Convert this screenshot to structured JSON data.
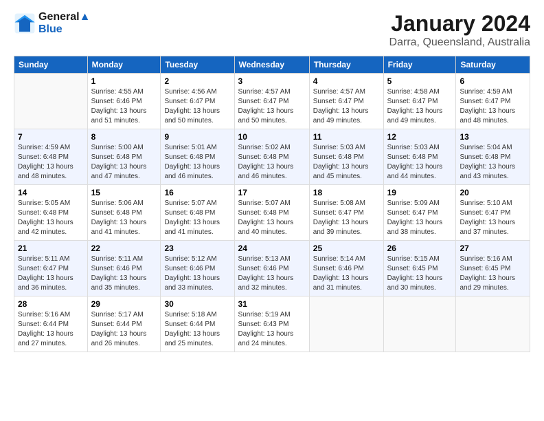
{
  "logo": {
    "line1": "General",
    "line2": "Blue"
  },
  "title": "January 2024",
  "subtitle": "Darra, Queensland, Australia",
  "header_days": [
    "Sunday",
    "Monday",
    "Tuesday",
    "Wednesday",
    "Thursday",
    "Friday",
    "Saturday"
  ],
  "weeks": [
    [
      {
        "day": "",
        "info": ""
      },
      {
        "day": "1",
        "info": "Sunrise: 4:55 AM\nSunset: 6:46 PM\nDaylight: 13 hours\nand 51 minutes."
      },
      {
        "day": "2",
        "info": "Sunrise: 4:56 AM\nSunset: 6:47 PM\nDaylight: 13 hours\nand 50 minutes."
      },
      {
        "day": "3",
        "info": "Sunrise: 4:57 AM\nSunset: 6:47 PM\nDaylight: 13 hours\nand 50 minutes."
      },
      {
        "day": "4",
        "info": "Sunrise: 4:57 AM\nSunset: 6:47 PM\nDaylight: 13 hours\nand 49 minutes."
      },
      {
        "day": "5",
        "info": "Sunrise: 4:58 AM\nSunset: 6:47 PM\nDaylight: 13 hours\nand 49 minutes."
      },
      {
        "day": "6",
        "info": "Sunrise: 4:59 AM\nSunset: 6:47 PM\nDaylight: 13 hours\nand 48 minutes."
      }
    ],
    [
      {
        "day": "7",
        "info": "Sunrise: 4:59 AM\nSunset: 6:48 PM\nDaylight: 13 hours\nand 48 minutes."
      },
      {
        "day": "8",
        "info": "Sunrise: 5:00 AM\nSunset: 6:48 PM\nDaylight: 13 hours\nand 47 minutes."
      },
      {
        "day": "9",
        "info": "Sunrise: 5:01 AM\nSunset: 6:48 PM\nDaylight: 13 hours\nand 46 minutes."
      },
      {
        "day": "10",
        "info": "Sunrise: 5:02 AM\nSunset: 6:48 PM\nDaylight: 13 hours\nand 46 minutes."
      },
      {
        "day": "11",
        "info": "Sunrise: 5:03 AM\nSunset: 6:48 PM\nDaylight: 13 hours\nand 45 minutes."
      },
      {
        "day": "12",
        "info": "Sunrise: 5:03 AM\nSunset: 6:48 PM\nDaylight: 13 hours\nand 44 minutes."
      },
      {
        "day": "13",
        "info": "Sunrise: 5:04 AM\nSunset: 6:48 PM\nDaylight: 13 hours\nand 43 minutes."
      }
    ],
    [
      {
        "day": "14",
        "info": "Sunrise: 5:05 AM\nSunset: 6:48 PM\nDaylight: 13 hours\nand 42 minutes."
      },
      {
        "day": "15",
        "info": "Sunrise: 5:06 AM\nSunset: 6:48 PM\nDaylight: 13 hours\nand 41 minutes."
      },
      {
        "day": "16",
        "info": "Sunrise: 5:07 AM\nSunset: 6:48 PM\nDaylight: 13 hours\nand 41 minutes."
      },
      {
        "day": "17",
        "info": "Sunrise: 5:07 AM\nSunset: 6:48 PM\nDaylight: 13 hours\nand 40 minutes."
      },
      {
        "day": "18",
        "info": "Sunrise: 5:08 AM\nSunset: 6:47 PM\nDaylight: 13 hours\nand 39 minutes."
      },
      {
        "day": "19",
        "info": "Sunrise: 5:09 AM\nSunset: 6:47 PM\nDaylight: 13 hours\nand 38 minutes."
      },
      {
        "day": "20",
        "info": "Sunrise: 5:10 AM\nSunset: 6:47 PM\nDaylight: 13 hours\nand 37 minutes."
      }
    ],
    [
      {
        "day": "21",
        "info": "Sunrise: 5:11 AM\nSunset: 6:47 PM\nDaylight: 13 hours\nand 36 minutes."
      },
      {
        "day": "22",
        "info": "Sunrise: 5:11 AM\nSunset: 6:46 PM\nDaylight: 13 hours\nand 35 minutes."
      },
      {
        "day": "23",
        "info": "Sunrise: 5:12 AM\nSunset: 6:46 PM\nDaylight: 13 hours\nand 33 minutes."
      },
      {
        "day": "24",
        "info": "Sunrise: 5:13 AM\nSunset: 6:46 PM\nDaylight: 13 hours\nand 32 minutes."
      },
      {
        "day": "25",
        "info": "Sunrise: 5:14 AM\nSunset: 6:46 PM\nDaylight: 13 hours\nand 31 minutes."
      },
      {
        "day": "26",
        "info": "Sunrise: 5:15 AM\nSunset: 6:45 PM\nDaylight: 13 hours\nand 30 minutes."
      },
      {
        "day": "27",
        "info": "Sunrise: 5:16 AM\nSunset: 6:45 PM\nDaylight: 13 hours\nand 29 minutes."
      }
    ],
    [
      {
        "day": "28",
        "info": "Sunrise: 5:16 AM\nSunset: 6:44 PM\nDaylight: 13 hours\nand 27 minutes."
      },
      {
        "day": "29",
        "info": "Sunrise: 5:17 AM\nSunset: 6:44 PM\nDaylight: 13 hours\nand 26 minutes."
      },
      {
        "day": "30",
        "info": "Sunrise: 5:18 AM\nSunset: 6:44 PM\nDaylight: 13 hours\nand 25 minutes."
      },
      {
        "day": "31",
        "info": "Sunrise: 5:19 AM\nSunset: 6:43 PM\nDaylight: 13 hours\nand 24 minutes."
      },
      {
        "day": "",
        "info": ""
      },
      {
        "day": "",
        "info": ""
      },
      {
        "day": "",
        "info": ""
      }
    ]
  ]
}
